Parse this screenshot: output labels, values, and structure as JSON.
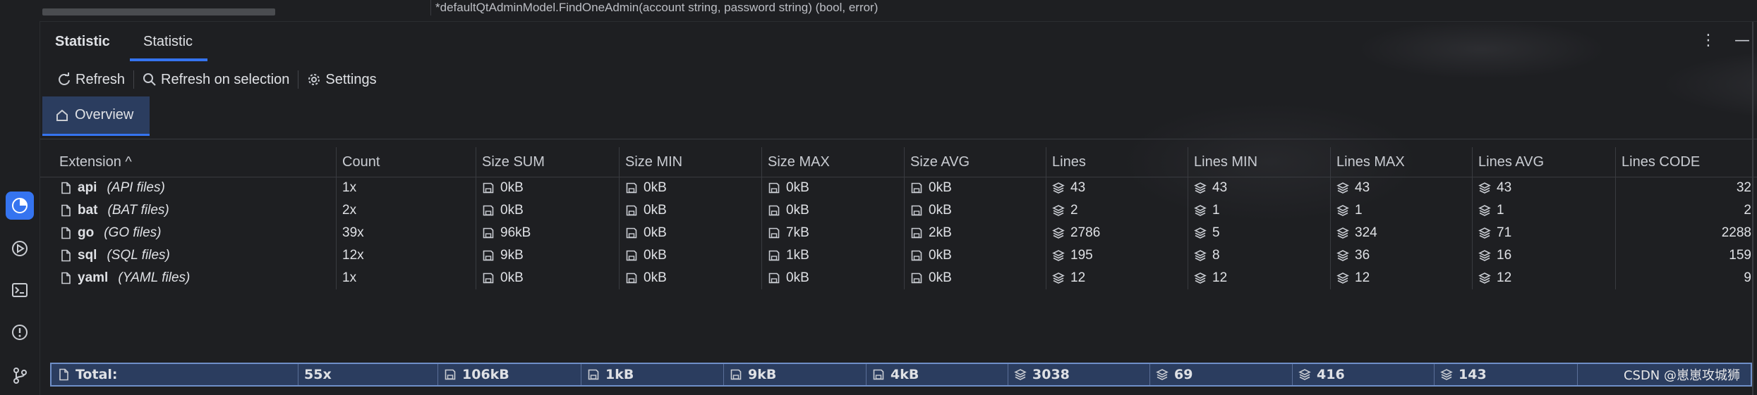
{
  "editor": {
    "signature": "*defaultQtAdminModel.FindOneAdmin(account string, password string) (bool, error)"
  },
  "tool_window": {
    "tabs": [
      {
        "label": "Statistic"
      },
      {
        "label": "Statistic"
      }
    ],
    "actions": {
      "more": "⋮",
      "minimize": "—"
    }
  },
  "toolbar": {
    "refresh": "Refresh",
    "refresh_selection": "Refresh on selection",
    "settings": "Settings"
  },
  "subtab": {
    "overview": "Overview"
  },
  "table": {
    "headers": [
      "Extension ^",
      "Count",
      "Size SUM",
      "Size MIN",
      "Size MAX",
      "Size AVG",
      "Lines",
      "Lines MIN",
      "Lines MAX",
      "Lines AVG",
      "Lines CODE"
    ],
    "rows": [
      {
        "ext": "api",
        "desc": "(API files)",
        "count": "1x",
        "size_sum": "0kB",
        "size_min": "0kB",
        "size_max": "0kB",
        "size_avg": "0kB",
        "lines": "43",
        "lines_min": "43",
        "lines_max": "43",
        "lines_avg": "43",
        "lines_code": "32"
      },
      {
        "ext": "bat",
        "desc": "(BAT files)",
        "count": "2x",
        "size_sum": "0kB",
        "size_min": "0kB",
        "size_max": "0kB",
        "size_avg": "0kB",
        "lines": "2",
        "lines_min": "1",
        "lines_max": "1",
        "lines_avg": "1",
        "lines_code": "2"
      },
      {
        "ext": "go",
        "desc": "(GO files)",
        "count": "39x",
        "size_sum": "96kB",
        "size_min": "0kB",
        "size_max": "7kB",
        "size_avg": "2kB",
        "lines": "2786",
        "lines_min": "5",
        "lines_max": "324",
        "lines_avg": "71",
        "lines_code": "2288"
      },
      {
        "ext": "sql",
        "desc": "(SQL files)",
        "count": "12x",
        "size_sum": "9kB",
        "size_min": "0kB",
        "size_max": "1kB",
        "size_avg": "0kB",
        "lines": "195",
        "lines_min": "8",
        "lines_max": "36",
        "lines_avg": "16",
        "lines_code": "159"
      },
      {
        "ext": "yaml",
        "desc": "(YAML files)",
        "count": "1x",
        "size_sum": "0kB",
        "size_min": "0kB",
        "size_max": "0kB",
        "size_avg": "0kB",
        "lines": "12",
        "lines_min": "12",
        "lines_max": "12",
        "lines_avg": "12",
        "lines_code": "9"
      }
    ],
    "total": {
      "label": "Total:",
      "count": "55x",
      "size_sum": "106kB",
      "size_min": "1kB",
      "size_max": "9kB",
      "size_avg": "4kB",
      "lines": "3038",
      "lines_min": "69",
      "lines_max": "416",
      "lines_avg": "143"
    }
  },
  "watermark": "CSDN @崽崽攻城狮",
  "icons": {
    "sidebar": [
      "statistic-icon",
      "run-icon",
      "terminal-icon",
      "problems-icon",
      "git-icon"
    ],
    "file": "file-icon",
    "size": "disk-icon",
    "lines": "stack-icon"
  },
  "colors": {
    "accent": "#3574f0",
    "background": "#1e1f22",
    "selection": "#2b3d5f",
    "text": "#dfe1e5"
  }
}
